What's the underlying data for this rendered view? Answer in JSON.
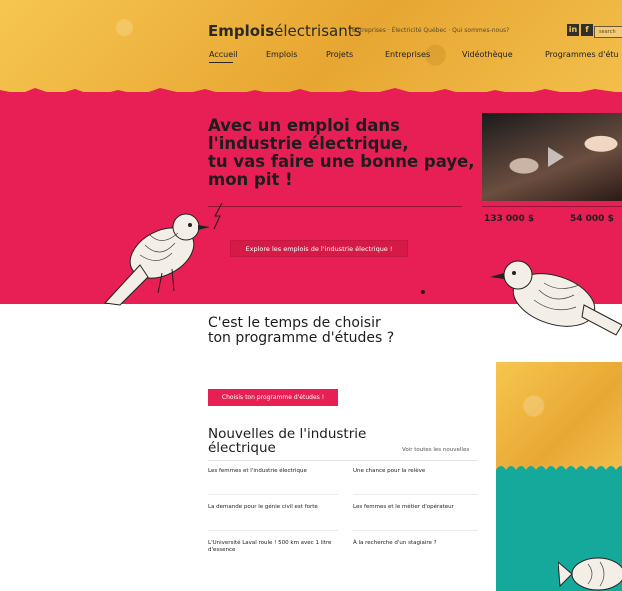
{
  "header": {
    "logo_bold": "Emplois",
    "logo_light": "électrisants",
    "utility_links": "Entreprises · Électricité Québec · Qui sommes-nous?",
    "social_icons": [
      "linkedin-icon",
      "facebook-icon"
    ],
    "social_glyphs": [
      "in",
      "f"
    ],
    "search_placeholder": "search"
  },
  "nav": {
    "items": [
      {
        "label": "Accueil",
        "active": true
      },
      {
        "label": "Emplois"
      },
      {
        "label": "Projets"
      },
      {
        "label": "Entreprises"
      },
      {
        "label": "Vidéothèque"
      },
      {
        "label": "Programmes d'étu"
      }
    ]
  },
  "hero": {
    "title": "Avec un emploi dans\nl'industrie électrique,\ntu vas faire une bonne paye,\nmon pit !",
    "subtitle": "",
    "cta": "Explore les emplois de l'industrie électrique !",
    "video_title": "",
    "stats": [
      {
        "value": "133 000 $",
        "desc": ""
      },
      {
        "value": "54 000 $",
        "desc": ""
      }
    ]
  },
  "programs": {
    "title": "C'est le temps de choisir\nton programme d'études ?",
    "description": "",
    "cta": "Choisis ton programme d'études !"
  },
  "news": {
    "title": "Nouvelles de l'industrie\nélectrique",
    "see_all": "Voir toutes les nouvelles",
    "items": [
      {
        "title": "Les femmes et l'industrie électrique",
        "meta": "",
        "more": ""
      },
      {
        "title": "Une chance pour la relève",
        "meta": "",
        "more": ""
      },
      {
        "title": "La demande pour le génie civil est forte",
        "meta": "",
        "more": ""
      },
      {
        "title": "Les femmes et le métier d'opérateur",
        "meta": "",
        "more": ""
      },
      {
        "title": "L'Université Laval roule ! 500 km avec 1 litre d'essence",
        "meta": "",
        "more": ""
      },
      {
        "title": "À la recherche d'un stagiaire ?",
        "meta": "",
        "more": ""
      }
    ]
  },
  "colors": {
    "hero_red": "#e81f55",
    "gold": "#f0b840",
    "teal": "#14a99b"
  }
}
